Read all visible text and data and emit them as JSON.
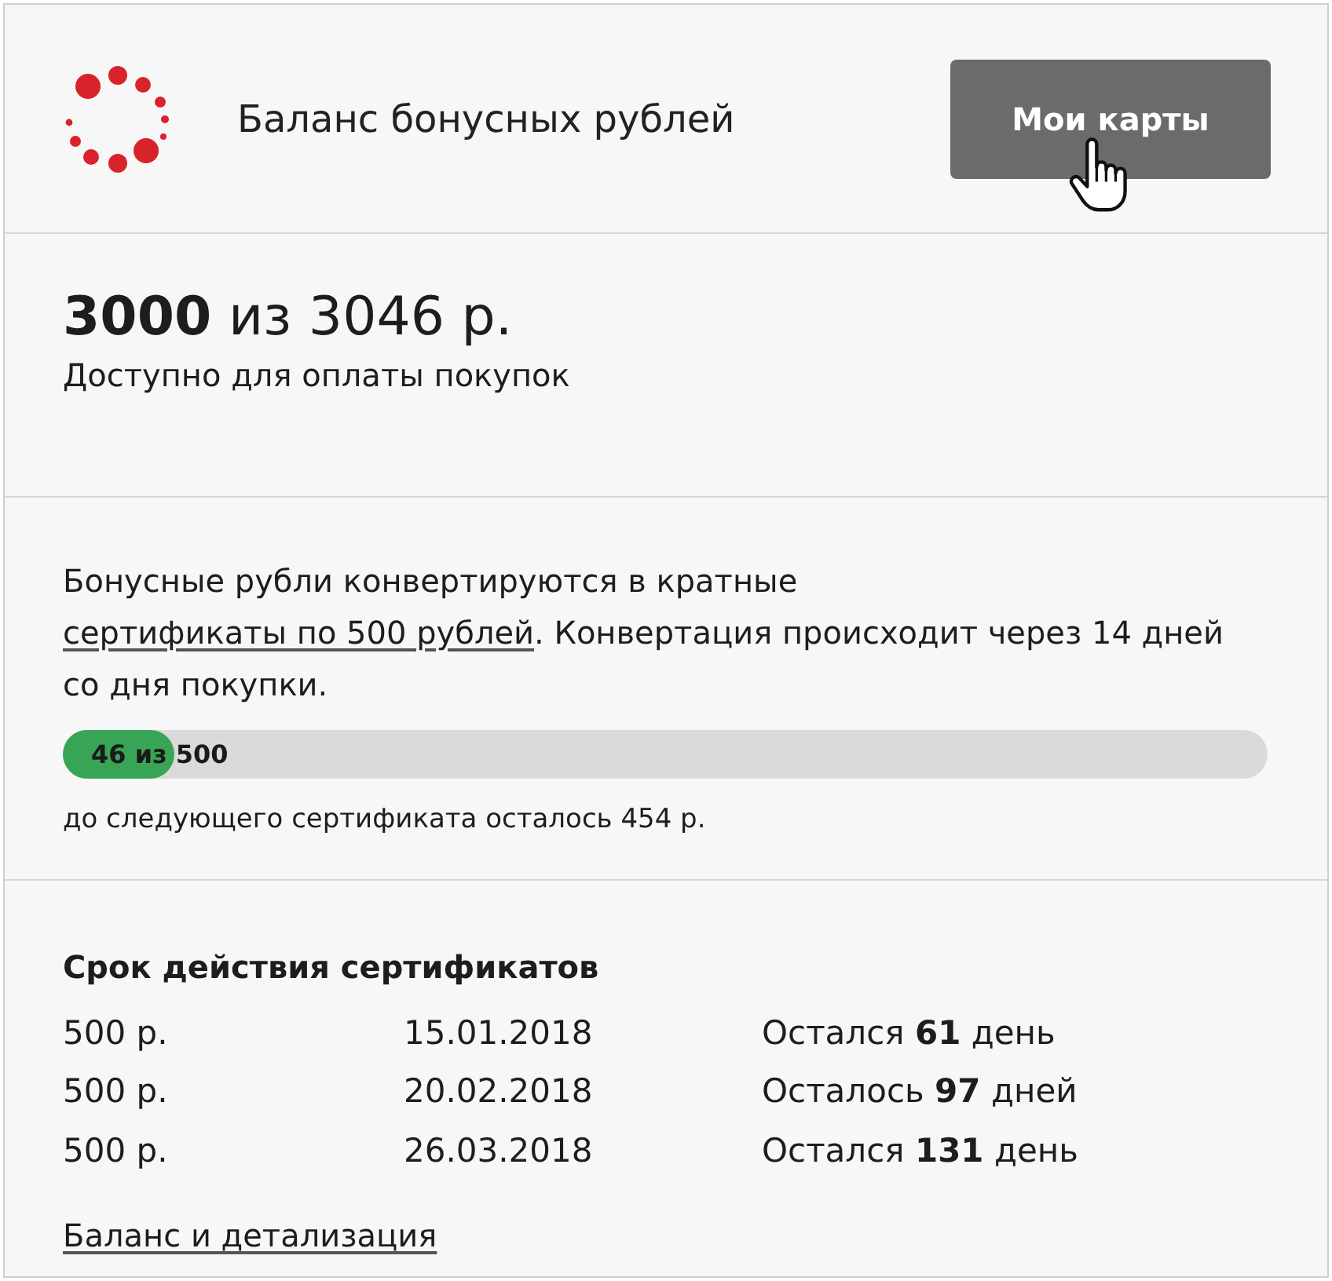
{
  "header": {
    "title": "Баланс бонусных рублей",
    "button": "Мои карты"
  },
  "balance": {
    "amount": "**3000** из 3046 р.",
    "caption": "Доступно для оплаты покупок"
  },
  "conversion": {
    "text_before": "Бонусные рубли конвертируются в кратные ",
    "link": "сертификаты по 500 рублей",
    "text_after": ". Конвертация происходит через 14 дней со дня покупки.",
    "progress": {
      "label": "46 из 500",
      "level": 0.092
    },
    "remaining": "до следующего сертификата осталось 454 р."
  },
  "certificates": {
    "title": "Срок действия сертификатов",
    "rows": [
      {
        "amount": "500 р.",
        "date": "15.01.2018",
        "remaining": "Остался **61** день"
      },
      {
        "amount": "500 р.",
        "date": "20.02.2018",
        "remaining": "Осталось **97** дней"
      },
      {
        "amount": "500 р.",
        "date": "26.03.2018",
        "remaining": "Остался **131** день"
      }
    ]
  },
  "footer_link": "Баланс и детализация"
}
